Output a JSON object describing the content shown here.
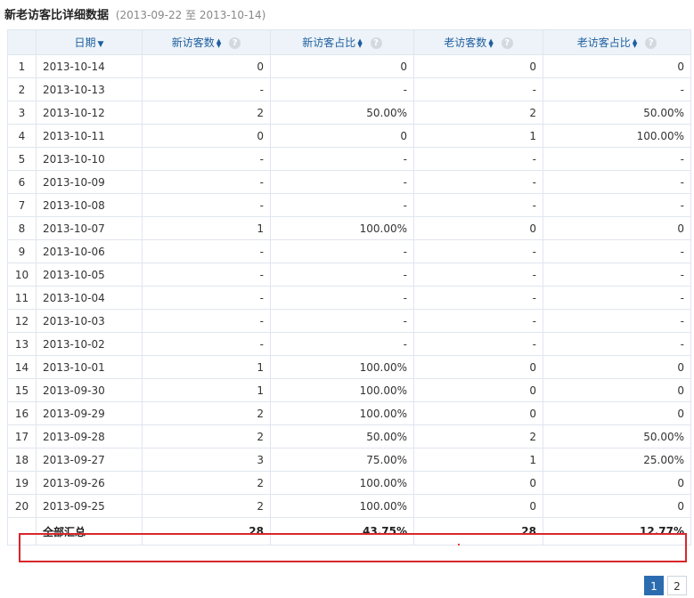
{
  "header": {
    "title": "新老访客比详细数据",
    "range": "(2013-09-22 至 2013-10-14)"
  },
  "columns": {
    "date": "日期",
    "new_visitors": "新访客数",
    "new_ratio": "新访客占比",
    "old_visitors": "老访客数",
    "old_ratio": "老访客占比"
  },
  "icons": {
    "sort_desc": "▼",
    "sort_up": "▲",
    "sort_down": "▼",
    "help": "?"
  },
  "rows": [
    {
      "idx": "1",
      "date": "2013-10-14",
      "new": "0",
      "new_ratio": "0",
      "old": "0",
      "old_ratio": "0"
    },
    {
      "idx": "2",
      "date": "2013-10-13",
      "new": "-",
      "new_ratio": "-",
      "old": "-",
      "old_ratio": "-"
    },
    {
      "idx": "3",
      "date": "2013-10-12",
      "new": "2",
      "new_ratio": "50.00%",
      "old": "2",
      "old_ratio": "50.00%"
    },
    {
      "idx": "4",
      "date": "2013-10-11",
      "new": "0",
      "new_ratio": "0",
      "old": "1",
      "old_ratio": "100.00%"
    },
    {
      "idx": "5",
      "date": "2013-10-10",
      "new": "-",
      "new_ratio": "-",
      "old": "-",
      "old_ratio": "-"
    },
    {
      "idx": "6",
      "date": "2013-10-09",
      "new": "-",
      "new_ratio": "-",
      "old": "-",
      "old_ratio": "-"
    },
    {
      "idx": "7",
      "date": "2013-10-08",
      "new": "-",
      "new_ratio": "-",
      "old": "-",
      "old_ratio": "-"
    },
    {
      "idx": "8",
      "date": "2013-10-07",
      "new": "1",
      "new_ratio": "100.00%",
      "old": "0",
      "old_ratio": "0"
    },
    {
      "idx": "9",
      "date": "2013-10-06",
      "new": "-",
      "new_ratio": "-",
      "old": "-",
      "old_ratio": "-"
    },
    {
      "idx": "10",
      "date": "2013-10-05",
      "new": "-",
      "new_ratio": "-",
      "old": "-",
      "old_ratio": "-"
    },
    {
      "idx": "11",
      "date": "2013-10-04",
      "new": "-",
      "new_ratio": "-",
      "old": "-",
      "old_ratio": "-"
    },
    {
      "idx": "12",
      "date": "2013-10-03",
      "new": "-",
      "new_ratio": "-",
      "old": "-",
      "old_ratio": "-"
    },
    {
      "idx": "13",
      "date": "2013-10-02",
      "new": "-",
      "new_ratio": "-",
      "old": "-",
      "old_ratio": "-"
    },
    {
      "idx": "14",
      "date": "2013-10-01",
      "new": "1",
      "new_ratio": "100.00%",
      "old": "0",
      "old_ratio": "0"
    },
    {
      "idx": "15",
      "date": "2013-09-30",
      "new": "1",
      "new_ratio": "100.00%",
      "old": "0",
      "old_ratio": "0"
    },
    {
      "idx": "16",
      "date": "2013-09-29",
      "new": "2",
      "new_ratio": "100.00%",
      "old": "0",
      "old_ratio": "0"
    },
    {
      "idx": "17",
      "date": "2013-09-28",
      "new": "2",
      "new_ratio": "50.00%",
      "old": "2",
      "old_ratio": "50.00%"
    },
    {
      "idx": "18",
      "date": "2013-09-27",
      "new": "3",
      "new_ratio": "75.00%",
      "old": "1",
      "old_ratio": "25.00%"
    },
    {
      "idx": "19",
      "date": "2013-09-26",
      "new": "2",
      "new_ratio": "100.00%",
      "old": "0",
      "old_ratio": "0"
    },
    {
      "idx": "20",
      "date": "2013-09-25",
      "new": "2",
      "new_ratio": "100.00%",
      "old": "0",
      "old_ratio": "0"
    }
  ],
  "total": {
    "label": "全部汇总",
    "new": "28",
    "new_ratio": "43.75%",
    "old": "28",
    "old_ratio": "12.77%"
  },
  "pagination": {
    "pages": [
      "1",
      "2"
    ],
    "current": "1"
  },
  "colors": {
    "accent": "#1f5f9e",
    "highlight": "#d8262b",
    "header_bg": "#edf3f9",
    "border": "#dfe6ee"
  }
}
